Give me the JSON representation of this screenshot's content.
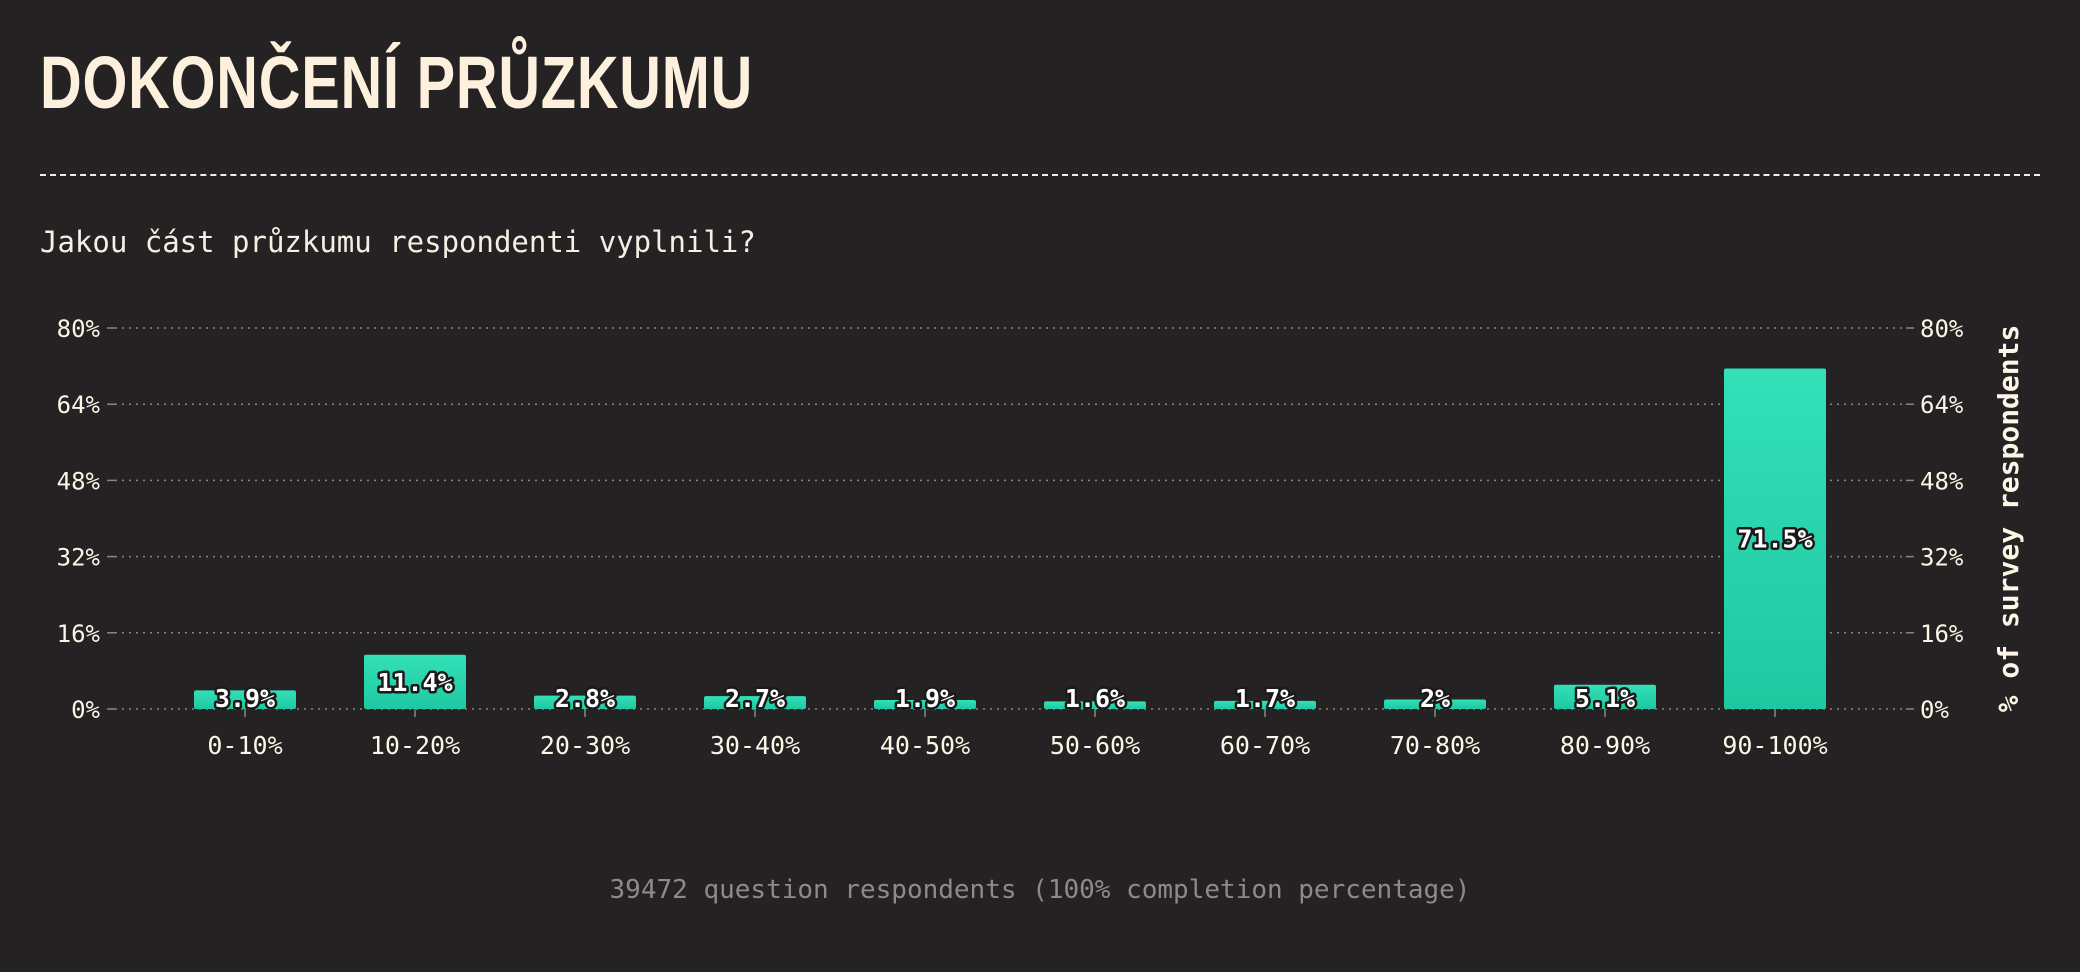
{
  "page": {
    "title": "DOKONČENÍ PRŮZKUMU",
    "subtitle": "Jakou část průzkumu respondenti vyplnili?",
    "footer": "39472 question respondents (100% completion percentage)"
  },
  "colors": {
    "background": "#252223",
    "bar_top": "#33e0b8",
    "bar_bottom": "#1fc8a0",
    "text": "#fdf5e6",
    "grid": "#8a8580",
    "muted": "#8f8a87"
  },
  "chart_data": {
    "type": "bar",
    "categories": [
      "0-10%",
      "10-20%",
      "20-30%",
      "30-40%",
      "40-50%",
      "50-60%",
      "60-70%",
      "70-80%",
      "80-90%",
      "90-100%"
    ],
    "values": [
      3.9,
      11.4,
      2.8,
      2.7,
      1.9,
      1.6,
      1.7,
      2,
      5.1,
      71.5
    ],
    "data_labels": [
      "3.9%",
      "11.4%",
      "2.8%",
      "2.7%",
      "1.9%",
      "1.6%",
      "1.7%",
      "2%",
      "5.1%",
      "71.5%"
    ],
    "y_ticks": [
      0,
      16,
      32,
      48,
      64,
      80
    ],
    "y_tick_labels": [
      "0%",
      "16%",
      "32%",
      "48%",
      "64%",
      "80%"
    ],
    "ylim": [
      0,
      80
    ],
    "ylabel_right": "% of survey respondents",
    "xlabel": "",
    "grid": true,
    "grid_style": "dotted",
    "y_axis_sides": [
      "left",
      "right"
    ]
  }
}
